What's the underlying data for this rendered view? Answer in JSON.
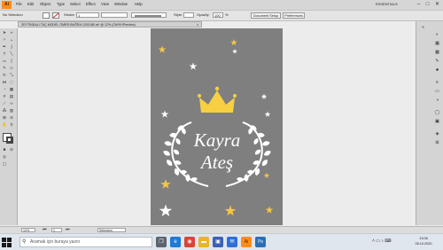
{
  "app": {
    "logo": "Ai",
    "menus": [
      "File",
      "Edit",
      "Object",
      "Type",
      "Select",
      "Effect",
      "View",
      "Window",
      "Help"
    ],
    "workspace": "ESSENTIALS",
    "window_controls": [
      "–",
      "□",
      "✕"
    ]
  },
  "control_bar": {
    "selection_label": "No Selection",
    "stroke_label": "Stroke:",
    "stroke_value": "1",
    "style_label": "Style:",
    "opacity_label": "Opacity:",
    "opacity_value": "100",
    "opacity_unit": "%",
    "document_setup": "Document Setup",
    "preferences": "Preferences"
  },
  "document": {
    "tab_title": "ZEYTİNDALI TAÇ MODEL ÖMER-BUĞRA 120X180.ai* @ 12% (CMYK/Preview)",
    "close": "×"
  },
  "artboard": {
    "background": "#7f7f80",
    "line1": "Kayra",
    "line2": "Ateş",
    "text_color": "#ffffff",
    "crown_color": "#f7cf43",
    "star_gold": "#f3c644",
    "star_white": "#ffffff"
  },
  "status_bar": {
    "zoom": "12%",
    "page": "1",
    "tool": "Selection"
  },
  "taskbar": {
    "search_placeholder": "Aramak için buraya yazın",
    "time": "13:06",
    "date": "28.10.2020",
    "apps": [
      {
        "name": "task-view",
        "glyph": "❐",
        "color": "#5b6470"
      },
      {
        "name": "edge",
        "glyph": "e",
        "color": "#1f7ad3"
      },
      {
        "name": "chrome",
        "glyph": "◉",
        "color": "#db4437"
      },
      {
        "name": "file-explorer",
        "glyph": "▬",
        "color": "#e8b428"
      },
      {
        "name": "store",
        "glyph": "▣",
        "color": "#3b5fb4"
      },
      {
        "name": "mail",
        "glyph": "✉",
        "color": "#2f6fd6"
      },
      {
        "name": "illustrator",
        "glyph": "Ai",
        "color": "#ff8c1a"
      },
      {
        "name": "photoshop",
        "glyph": "Ps",
        "color": "#2b6fb6"
      }
    ]
  }
}
